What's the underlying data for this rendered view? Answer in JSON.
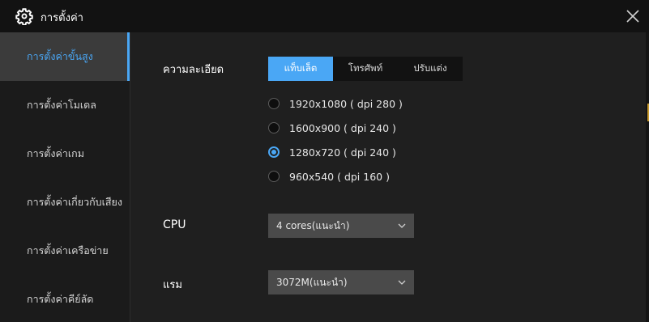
{
  "window": {
    "title": "การตั้งค่า",
    "title_icon": "gear-icon",
    "close_icon": "close-icon"
  },
  "sidebar": {
    "items": [
      {
        "label": "การตั้งค่าขั้นสูง",
        "active": true
      },
      {
        "label": "การตั้งค่าโมเดล",
        "active": false
      },
      {
        "label": "การตั้งค่าเกม",
        "active": false
      },
      {
        "label": "การตั้งค่าเกี่ยวกับเสียง",
        "active": false
      },
      {
        "label": "การตั้งค่าเครือข่าย",
        "active": false
      },
      {
        "label": "การตั้งค่าคีย์ลัด",
        "active": false
      }
    ]
  },
  "resolution": {
    "label": "ความละเอียด",
    "tabs": [
      {
        "label": "แท็บเล็ต",
        "active": true
      },
      {
        "label": "โทรศัพท์",
        "active": false
      },
      {
        "label": "ปรับแต่ง",
        "active": false
      }
    ],
    "options": [
      {
        "label": "1920x1080 ( dpi 280 )",
        "checked": false
      },
      {
        "label": "1600x900 ( dpi 240 )",
        "checked": false
      },
      {
        "label": "1280x720 ( dpi 240 )",
        "checked": true
      },
      {
        "label": "960x540 ( dpi 160 )",
        "checked": false
      }
    ]
  },
  "cpu": {
    "label": "CPU",
    "value": "4 cores(แนะนำ)"
  },
  "ram": {
    "label": "แรม",
    "value": "3072M(แนะนำ)"
  },
  "colors": {
    "accent": "#4aa7f5",
    "background": "#1f1f1f",
    "titlebar": "#121212"
  }
}
